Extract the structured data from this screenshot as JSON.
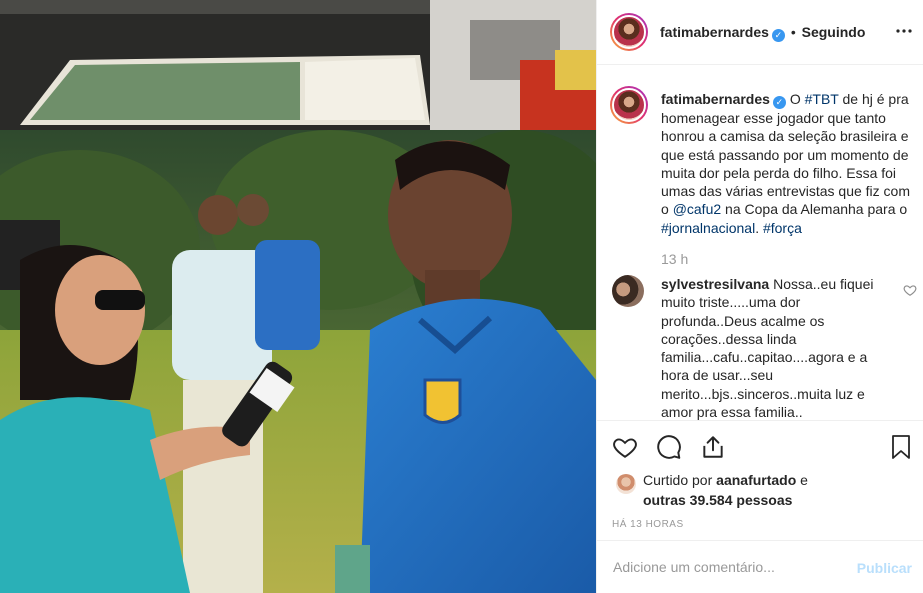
{
  "post": {
    "author": "fatimabernardes",
    "follow_separator": "•",
    "follow_status": "Seguindo",
    "more_icon": "ellipsis-icon",
    "caption": {
      "username": "fatimabernardes",
      "parts": [
        {
          "t": " O ",
          "link": false
        },
        {
          "t": "#TBT",
          "link": true
        },
        {
          "t": " de hj é pra homenagear esse jogador que tanto honrou a camisa da seleção brasileira e que está passando por um momento de muita dor pela perda do filho. Essa foi umas das várias entrevistas que fiz com o ",
          "link": false
        },
        {
          "t": "@cafu2",
          "link": true
        },
        {
          "t": " na Copa da Alemanha para o ",
          "link": false
        },
        {
          "t": "#jornalnacional",
          "link": true
        },
        {
          "t": ". ",
          "link": false
        },
        {
          "t": "#força",
          "link": true
        }
      ]
    },
    "caption_time": "13 h",
    "comments": [
      {
        "username": "sylvestresilvana",
        "text": " Nossa..eu fiquei muito triste.....uma dor profunda..Deus acalme os corações..dessa linda familia...cafu..capitao....agora e a hora de usar...seu merito...bjs..sinceros..muita luz e amor pra essa familia.."
      }
    ],
    "likes": {
      "prefix": "Curtido por ",
      "user": "aanafurtado",
      "suffix": " e",
      "others": "outras 39.584 pessoas"
    },
    "time_ago": "HÁ 13 HORAS",
    "comment_input": {
      "placeholder": "Adicione um comentário...",
      "value": ""
    },
    "publish_label": "Publicar",
    "icons": [
      "heart-icon",
      "comment-icon",
      "share-icon",
      "bookmark-icon",
      "verified-badge-icon"
    ]
  },
  "colors": {
    "accent_blue": "#3897f0",
    "link_blue": "#003569",
    "muted_gray": "#999999",
    "publish_disabled": "#b9dffc",
    "divider": "#efefef"
  }
}
